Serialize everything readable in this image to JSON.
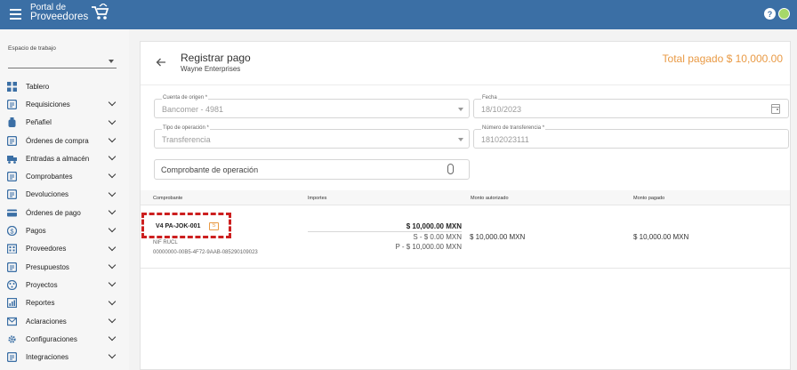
{
  "app": {
    "logo_line1": "Portal de",
    "logo_line2": "Proveedores"
  },
  "sidebar": {
    "workspace_label": "Espacio de trabajo",
    "workspace_value": "",
    "items": [
      {
        "label": "Tablero",
        "icon": "dashboard-icon",
        "expandable": false
      },
      {
        "label": "Requisiciones",
        "icon": "list-icon",
        "expandable": true
      },
      {
        "label": "Peñafiel",
        "icon": "bottle-icon",
        "expandable": true
      },
      {
        "label": "Órdenes de compra",
        "icon": "purchase-order-icon",
        "expandable": true
      },
      {
        "label": "Entradas a almacén",
        "icon": "truck-icon",
        "expandable": true
      },
      {
        "label": "Comprobantes",
        "icon": "document-icon",
        "expandable": true
      },
      {
        "label": "Devoluciones",
        "icon": "returns-icon",
        "expandable": true
      },
      {
        "label": "Órdenes de pago",
        "icon": "card-icon",
        "expandable": true
      },
      {
        "label": "Pagos",
        "icon": "dollar-icon",
        "expandable": true
      },
      {
        "label": "Proveedores",
        "icon": "building-icon",
        "expandable": true
      },
      {
        "label": "Presupuestos",
        "icon": "budget-icon",
        "expandable": true
      },
      {
        "label": "Proyectos",
        "icon": "projects-icon",
        "expandable": true
      },
      {
        "label": "Reportes",
        "icon": "reports-icon",
        "expandable": true
      },
      {
        "label": "Aclaraciones",
        "icon": "mail-icon",
        "expandable": true
      },
      {
        "label": "Configuraciones",
        "icon": "gear-icon",
        "expandable": true
      },
      {
        "label": "Integraciones",
        "icon": "integrations-icon",
        "expandable": true
      }
    ]
  },
  "header": {
    "title": "Registrar pago",
    "subtitle": "Wayne Enterprises",
    "total_label": "Total pagado  $ 10,000.00"
  },
  "form": {
    "origin_label": "Cuenta de origen *",
    "origin_value": "Bancomer - 4981",
    "date_label": "Fecha",
    "date_value": "18/10/2023",
    "op_type_label": "Tipo de operación *",
    "op_type_value": "Transferencia",
    "transfer_label": "Número de transferencia *",
    "transfer_value": "18102023111",
    "proof_label": "Comprobante de operación"
  },
  "table": {
    "headers": [
      "Comprobante",
      "Importes",
      "Monto autorizado",
      "Monto pagado"
    ],
    "rows": [
      {
        "invoice": "V4 PA-JOK-001",
        "badge": "S",
        "rfc": "NIF RUCL",
        "uuid": "00000000-00B5-4F72-9AAB-085290109023",
        "total": "$ 10,000.00 MXN",
        "s_amount": "S - $ 0.00 MXN",
        "p_amount": "P - $ 10,000.00 MXN",
        "authorized": "$ 10,000.00 MXN",
        "paid": "$ 10,000.00 MXN"
      }
    ]
  },
  "colors": {
    "topbar": "#3b6fa5",
    "accent": "#e99a45",
    "highlight": "#cc1f1f"
  }
}
